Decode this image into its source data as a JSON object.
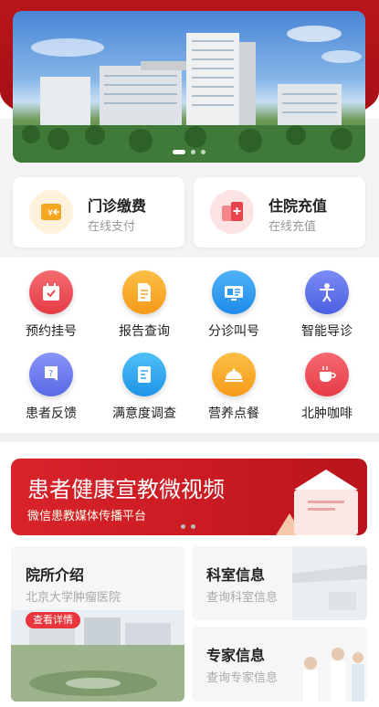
{
  "banner": {
    "slides": 3,
    "active": 0
  },
  "payments": [
    {
      "title": "门诊缴费",
      "subtitle": "在线支付",
      "icon": "yen-card-icon",
      "color": "#f5a623"
    },
    {
      "title": "住院充值",
      "subtitle": "在线充值",
      "icon": "hospital-plus-icon",
      "color": "#e8424a"
    }
  ],
  "services": [
    {
      "label": "预约挂号",
      "icon": "calendar-check-icon",
      "color": "#ec4a55"
    },
    {
      "label": "报告查询",
      "icon": "report-doc-icon",
      "color": "#f7a928"
    },
    {
      "label": "分诊叫号",
      "icon": "queue-screen-icon",
      "color": "#2f9bef"
    },
    {
      "label": "智能导诊",
      "icon": "body-guide-icon",
      "color": "#5a6ee8"
    },
    {
      "label": "患者反馈",
      "icon": "feedback-question-icon",
      "color": "#6a7cf0"
    },
    {
      "label": "满意度调查",
      "icon": "survey-icon",
      "color": "#2fa6f0"
    },
    {
      "label": "营养点餐",
      "icon": "food-cloche-icon",
      "color": "#f7a928"
    },
    {
      "label": "北肿咖啡",
      "icon": "coffee-cup-icon",
      "color": "#ec4a55"
    }
  ],
  "promo": {
    "title": "患者健康宣教微视频",
    "subtitle": "微信患教媒体传播平台",
    "slides": 2
  },
  "intro": {
    "title": "院所介绍",
    "subtitle": "北京大学肿瘤医院",
    "button": "查看详情"
  },
  "dept": {
    "title": "科室信息",
    "subtitle": "查询科室信息"
  },
  "expert": {
    "title": "专家信息",
    "subtitle": "查询专家信息"
  }
}
